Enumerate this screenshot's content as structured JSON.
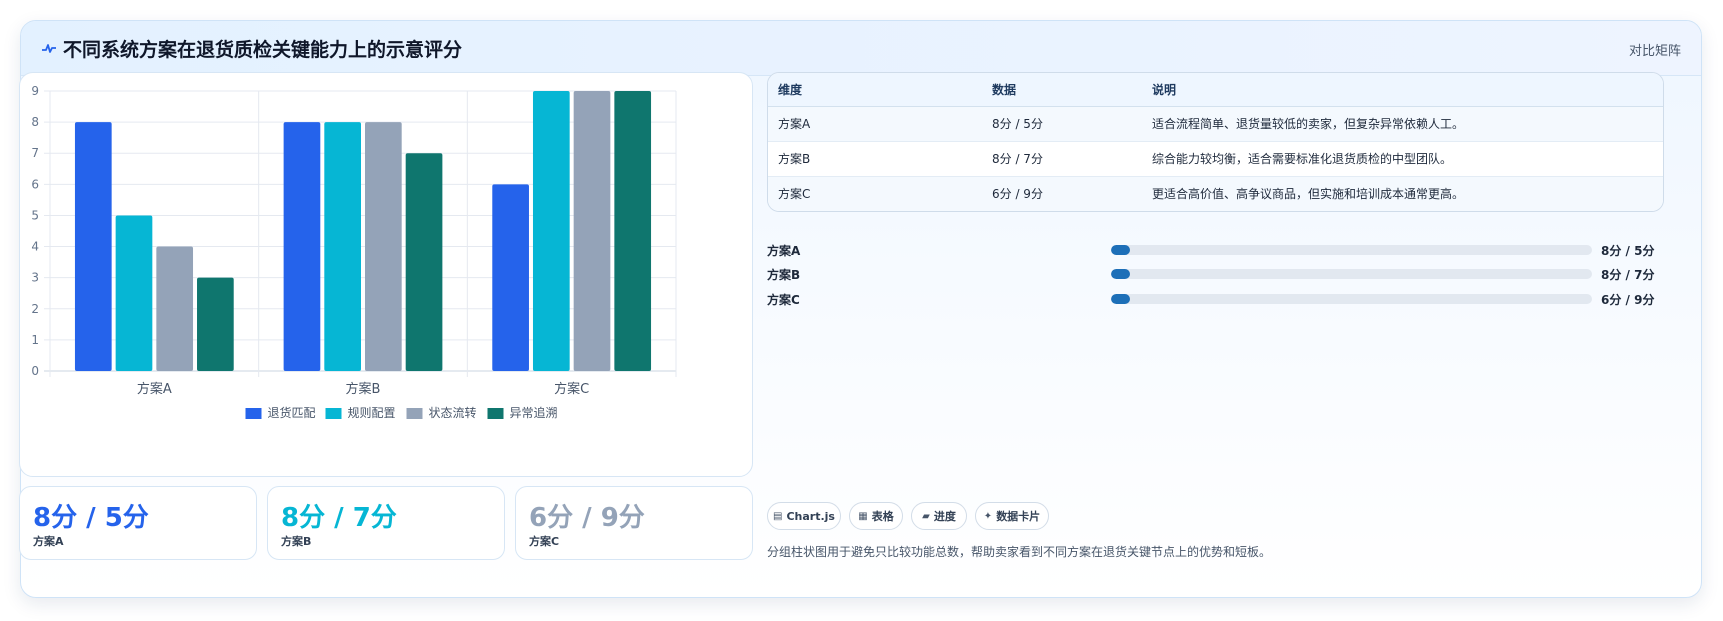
{
  "header": {
    "title": "不同系统方案在退货质检关键能力上的示意评分",
    "badge": "对比矩阵",
    "icon": "pulse-icon"
  },
  "colors": {
    "退货匹配": "#2563eb",
    "规则配置": "#06b6d4",
    "状态流转": "#94a3b8",
    "异常追溯": "#0f766e",
    "progress": "#1d6fb8"
  },
  "chart_data": {
    "type": "bar",
    "categories": [
      "方案A",
      "方案B",
      "方案C"
    ],
    "series": [
      {
        "name": "退货匹配",
        "values": [
          8,
          8,
          6
        ]
      },
      {
        "name": "规则配置",
        "values": [
          5,
          8,
          9
        ]
      },
      {
        "name": "状态流转",
        "values": [
          4,
          8,
          9
        ]
      },
      {
        "name": "异常追溯",
        "values": [
          3,
          7,
          9
        ]
      }
    ],
    "ylim": [
      0,
      9
    ],
    "yticks": [
      "0",
      "1",
      "2",
      "3",
      "4",
      "5",
      "6",
      "7",
      "8",
      "9"
    ],
    "grid": true,
    "legend_position": "bottom"
  },
  "stats": [
    {
      "value": "8分 / 5分",
      "label": "方案A",
      "color": "#2563eb"
    },
    {
      "value": "8分 / 7分",
      "label": "方案B",
      "color": "#06b6d4"
    },
    {
      "value": "6分 / 9分",
      "label": "方案C",
      "color": "#94a3b8"
    }
  ],
  "table": {
    "headers": [
      "维度",
      "数据",
      "说明"
    ],
    "rows": [
      [
        "方案A",
        "8分 / 5分",
        "适合流程简单、退货量较低的卖家，但复杂异常依赖人工。"
      ],
      [
        "方案B",
        "8分 / 7分",
        "综合能力较均衡，适合需要标准化退货质检的中型团队。"
      ],
      [
        "方案C",
        "6分 / 9分",
        "更适合高价值、高争议商品，但实施和培训成本通常更高。"
      ]
    ]
  },
  "progress": [
    {
      "name": "方案A",
      "text": "8分 / 5分",
      "fraction": 0.04
    },
    {
      "name": "方案B",
      "text": "8分 / 7分",
      "fraction": 0.04
    },
    {
      "name": "方案C",
      "text": "6分 / 9分",
      "fraction": 0.04
    }
  ],
  "chips": [
    {
      "icon": "▤",
      "label": "Chart.js"
    },
    {
      "icon": "▦",
      "label": "表格"
    },
    {
      "icon": "▰",
      "label": "进度"
    },
    {
      "icon": "✦",
      "label": "数据卡片"
    }
  ],
  "footnote": "分组柱状图用于避免只比较功能总数，帮助卖家看到不同方案在退货关键节点上的优势和短板。"
}
